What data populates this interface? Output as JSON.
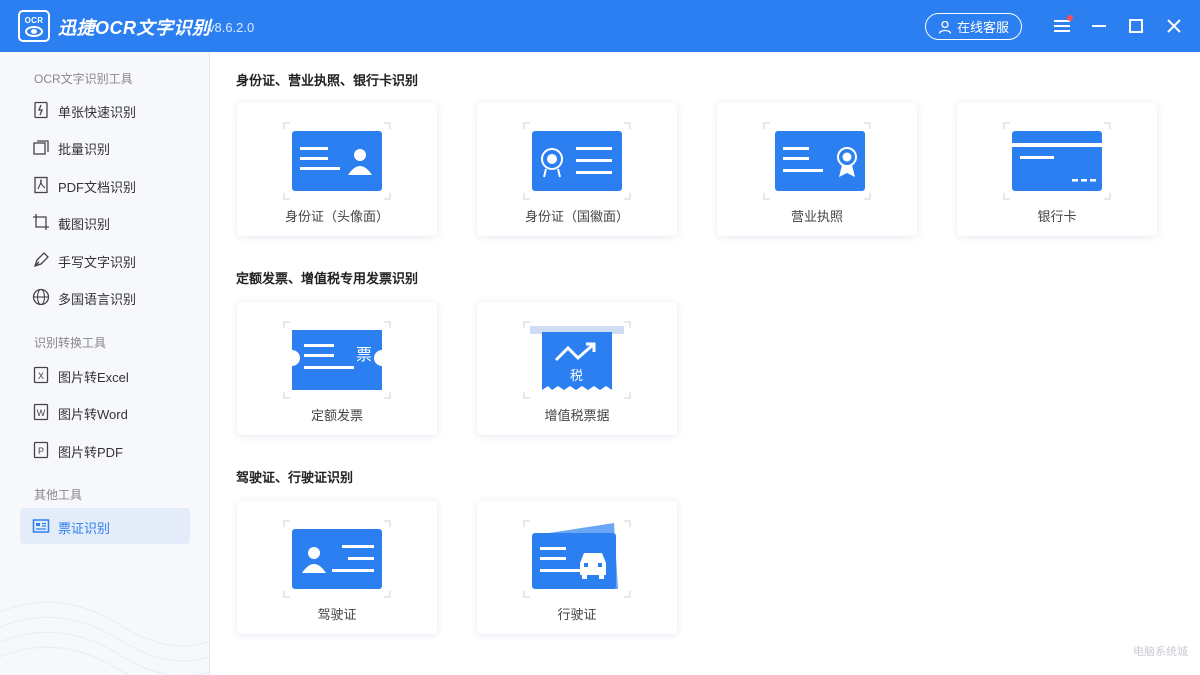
{
  "app": {
    "logo_text": "OCR",
    "title": "迅捷OCR文字识别",
    "version": "v8.6.2.0",
    "service_button": "在线客服"
  },
  "window_controls": [
    "menu-icon",
    "minimize-icon",
    "maximize-icon",
    "close-icon"
  ],
  "colors": {
    "brand": "#2b7ff0",
    "sidebar_bg": "#f6f8fc",
    "active_bg": "#e4ecfa",
    "notification": "#ff4d4f"
  },
  "sidebar": {
    "groups": [
      {
        "title": "OCR文字识别工具",
        "items": [
          {
            "label": "单张快速识别",
            "icon": "single-doc-icon"
          },
          {
            "label": "批量识别",
            "icon": "batch-icon"
          },
          {
            "label": "PDF文档识别",
            "icon": "pdf-icon"
          },
          {
            "label": "截图识别",
            "icon": "crop-icon"
          },
          {
            "label": "手写文字识别",
            "icon": "pen-icon"
          },
          {
            "label": "多国语言识别",
            "icon": "globe-icon"
          }
        ]
      },
      {
        "title": "识别转换工具",
        "items": [
          {
            "label": "图片转Excel",
            "icon": "excel-icon",
            "badge": "X"
          },
          {
            "label": "图片转Word",
            "icon": "word-icon",
            "badge": "W"
          },
          {
            "label": "图片转PDF",
            "icon": "pdf-file-icon",
            "badge": "P"
          }
        ]
      },
      {
        "title": "其他工具",
        "items": [
          {
            "label": "票证识别",
            "icon": "ticket-icon",
            "active": true
          }
        ]
      }
    ]
  },
  "sections": [
    {
      "title": "身份证、营业执照、银行卡识别",
      "cards": [
        {
          "label": "身份证（头像面）",
          "icon": "id-card-front-icon"
        },
        {
          "label": "身份证（国徽面）",
          "icon": "id-card-back-icon"
        },
        {
          "label": "营业执照",
          "icon": "business-license-icon"
        },
        {
          "label": "银行卡",
          "icon": "bank-card-icon"
        }
      ]
    },
    {
      "title": "定额发票、增值税专用发票识别",
      "cards": [
        {
          "label": "定额发票",
          "icon": "quota-invoice-icon",
          "glyph": "票"
        },
        {
          "label": "增值税票据",
          "icon": "vat-invoice-icon",
          "glyph": "税"
        }
      ]
    },
    {
      "title": "驾驶证、行驶证识别",
      "cards": [
        {
          "label": "驾驶证",
          "icon": "driver-license-icon"
        },
        {
          "label": "行驶证",
          "icon": "vehicle-license-icon"
        }
      ]
    }
  ],
  "watermark": "电脑系统城"
}
